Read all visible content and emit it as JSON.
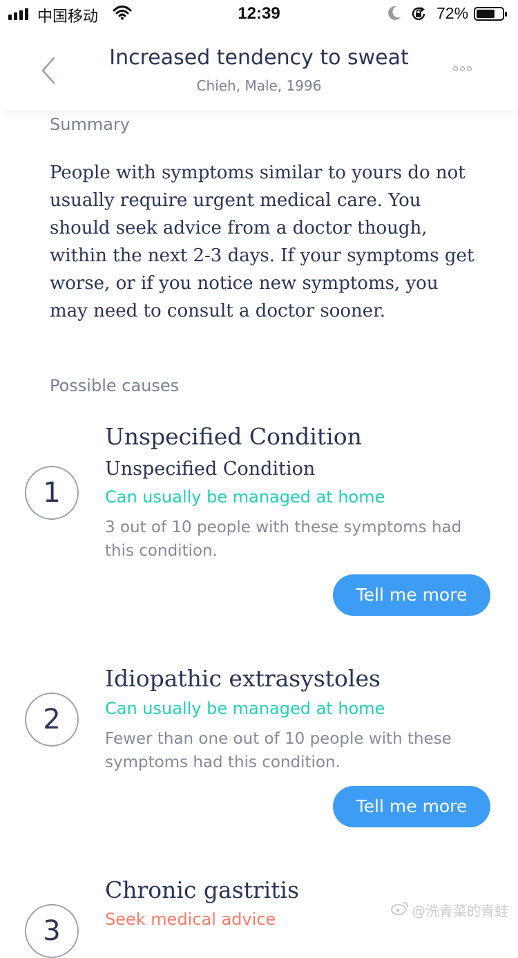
{
  "status_bar": {
    "carrier": "中国移动",
    "time": "12:39",
    "battery_percent": "72%",
    "battery_level": 0.72
  },
  "header": {
    "title": "Increased tendency to sweat",
    "subtitle": "Chieh, Male, 1996",
    "icons": [
      "chevron-left-icon",
      "more-icon"
    ]
  },
  "summary": {
    "label": "Summary",
    "text": "People with symptoms similar to yours do not usually require urgent medical care. You should seek advice from a doctor though, within the next 2-3 days. If your symptoms get worse, or if you notice new symptoms, you may need to consult a doctor sooner."
  },
  "causes": {
    "label": "Possible causes",
    "items": [
      {
        "number": "1",
        "title": "Unspecified Condition",
        "subtitle": "Unspecified Condition",
        "triage": "Can usually be managed at home",
        "triage_color": "#1ed2b4",
        "description": "3 out of 10 people with these symptoms had this condition.",
        "button": "Tell me more"
      },
      {
        "number": "2",
        "title": "Idiopathic extrasystoles",
        "triage": "Can usually be managed at home",
        "triage_color": "#1ed2b4",
        "description": "Fewer than one out of 10 people with these symptoms had this condition.",
        "button": "Tell me more"
      },
      {
        "number": "3",
        "title": "Chronic gastritis",
        "triage": "Seek medical advice",
        "triage_color": "#ff7a66"
      }
    ]
  },
  "watermark": "@洗青菜的青蛙",
  "colors": {
    "primary_text": "#2a3458",
    "secondary_text": "#7b8196",
    "button_blue": "#3d9df5"
  }
}
